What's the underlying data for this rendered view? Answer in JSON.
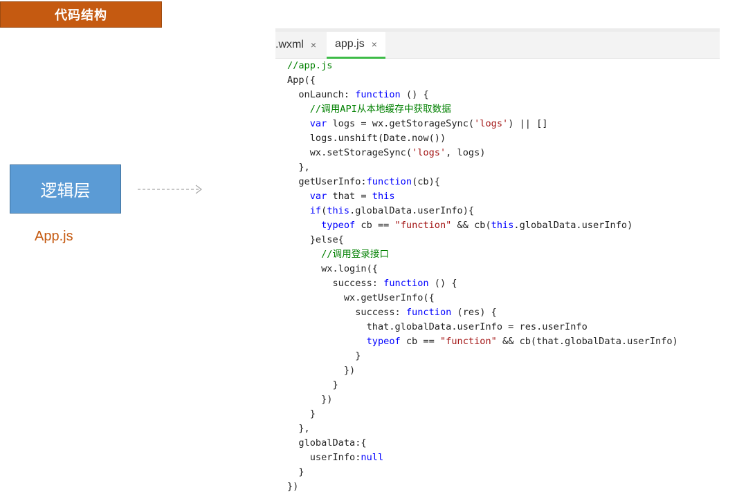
{
  "slide": {
    "title": "代码结构",
    "layer_label": "逻辑层",
    "file_caption": "App.js"
  },
  "colors": {
    "banner": "#c55a11",
    "layer_box": "#5b9bd5",
    "caption": "#c55a11",
    "active_tab_underline": "#3dbb47",
    "keyword": "#0000ff",
    "string": "#a31515",
    "comment": "#008000"
  },
  "editor": {
    "tabs": [
      {
        "label": ".wxml",
        "close": "×",
        "active": false
      },
      {
        "label": "app.js",
        "close": "×",
        "active": true
      }
    ],
    "code_lines": [
      [
        [
          "c",
          "//app.js"
        ]
      ],
      [
        [
          "p",
          "App({"
        ]
      ],
      [
        [
          "p",
          "  onLaunch: "
        ],
        [
          "k",
          "function"
        ],
        [
          "p",
          " () {"
        ]
      ],
      [
        [
          "c",
          "    //调用API从本地缓存中获取数据"
        ]
      ],
      [
        [
          "p",
          "    "
        ],
        [
          "k",
          "var"
        ],
        [
          "p",
          " logs = wx.getStorageSync("
        ],
        [
          "s",
          "'logs'"
        ],
        [
          "p",
          ") || []"
        ]
      ],
      [
        [
          "p",
          "    logs.unshift(Date.now())"
        ]
      ],
      [
        [
          "p",
          "    wx.setStorageSync("
        ],
        [
          "s",
          "'logs'"
        ],
        [
          "p",
          ", logs)"
        ]
      ],
      [
        [
          "p",
          "  },"
        ]
      ],
      [
        [
          "p",
          "  getUserInfo:"
        ],
        [
          "k",
          "function"
        ],
        [
          "p",
          "(cb){"
        ]
      ],
      [
        [
          "p",
          "    "
        ],
        [
          "k",
          "var"
        ],
        [
          "p",
          " that = "
        ],
        [
          "k",
          "this"
        ]
      ],
      [
        [
          "p",
          "    "
        ],
        [
          "k",
          "if"
        ],
        [
          "p",
          "("
        ],
        [
          "k",
          "this"
        ],
        [
          "p",
          ".globalData.userInfo){"
        ]
      ],
      [
        [
          "p",
          "      "
        ],
        [
          "k",
          "typeof"
        ],
        [
          "p",
          " cb == "
        ],
        [
          "s",
          "\"function\""
        ],
        [
          "p",
          " && cb("
        ],
        [
          "k",
          "this"
        ],
        [
          "p",
          ".globalData.userInfo)"
        ]
      ],
      [
        [
          "p",
          "    }else{"
        ]
      ],
      [
        [
          "c",
          "      //调用登录接口"
        ]
      ],
      [
        [
          "p",
          "      wx.login({"
        ]
      ],
      [
        [
          "p",
          "        success: "
        ],
        [
          "k",
          "function"
        ],
        [
          "p",
          " () {"
        ]
      ],
      [
        [
          "p",
          "          wx.getUserInfo({"
        ]
      ],
      [
        [
          "p",
          "            success: "
        ],
        [
          "k",
          "function"
        ],
        [
          "p",
          " (res) {"
        ]
      ],
      [
        [
          "p",
          "              that.globalData.userInfo = res.userInfo"
        ]
      ],
      [
        [
          "p",
          "              "
        ],
        [
          "k",
          "typeof"
        ],
        [
          "p",
          " cb == "
        ],
        [
          "s",
          "\"function\""
        ],
        [
          "p",
          " && cb(that.globalData.userInfo)"
        ]
      ],
      [
        [
          "p",
          "            }"
        ]
      ],
      [
        [
          "p",
          "          })"
        ]
      ],
      [
        [
          "p",
          "        }"
        ]
      ],
      [
        [
          "p",
          "      })"
        ]
      ],
      [
        [
          "p",
          "    }"
        ]
      ],
      [
        [
          "p",
          "  },"
        ]
      ],
      [
        [
          "p",
          "  globalData:{"
        ]
      ],
      [
        [
          "p",
          "    userInfo:"
        ],
        [
          "k",
          "null"
        ]
      ],
      [
        [
          "p",
          "  }"
        ]
      ],
      [
        [
          "p",
          "})"
        ]
      ]
    ]
  }
}
